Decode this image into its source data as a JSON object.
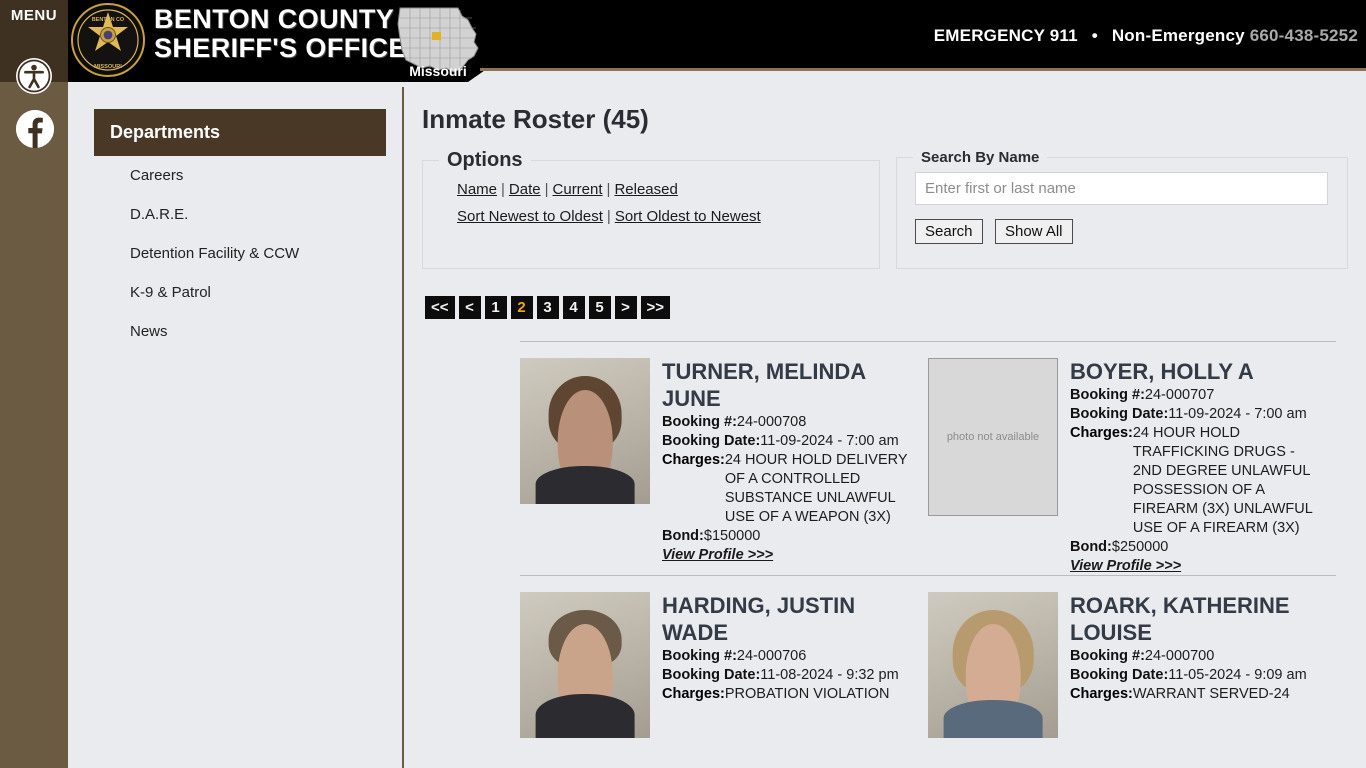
{
  "rail": {
    "menu_label": "MENU",
    "accessibility_icon": "accessibility-icon",
    "facebook_icon": "facebook-icon",
    "menu_icon": "hamburger-menu-icon"
  },
  "header": {
    "title_line1": "BENTON COUNTY",
    "title_line2": "SHERIFF'S OFFICE",
    "badge_icon": "sheriff-badge-icon",
    "state_map_icon": "missouri-map-icon",
    "state_label": "Missouri",
    "emergency_label": "EMERGENCY 911",
    "separator": "•",
    "non_emergency_label": "Non-Emergency",
    "non_emergency_number": "660-438-5252"
  },
  "sidebar": {
    "header": "Departments",
    "items": [
      {
        "label": "Careers"
      },
      {
        "label": "D.A.R.E."
      },
      {
        "label": "Detention Facility & CCW"
      },
      {
        "label": "K-9 & Patrol"
      },
      {
        "label": "News"
      }
    ]
  },
  "main": {
    "page_title": "Inmate Roster (45)",
    "options": {
      "legend": "Options",
      "row1": [
        {
          "label": "Name"
        },
        {
          "label": "Date"
        },
        {
          "label": "Current"
        },
        {
          "label": "Released"
        }
      ],
      "row2": [
        {
          "label": "Sort Newest to Oldest"
        },
        {
          "label": "Sort Oldest to Newest"
        }
      ],
      "separator": "|"
    },
    "search": {
      "legend": "Search By Name",
      "value": "",
      "placeholder": "Enter first or last name",
      "search_button": "Search",
      "show_all_button": "Show All"
    },
    "pagination": {
      "current": "2",
      "items": [
        {
          "label": "<<",
          "current": false
        },
        {
          "label": "<",
          "current": false
        },
        {
          "label": "1",
          "current": false
        },
        {
          "label": "2",
          "current": true
        },
        {
          "label": "3",
          "current": false
        },
        {
          "label": "4",
          "current": false
        },
        {
          "label": "5",
          "current": false
        },
        {
          "label": ">",
          "current": false
        },
        {
          "label": ">>",
          "current": false
        }
      ]
    },
    "labels": {
      "booking_number": "Booking #:",
      "booking_date": "Booking Date:",
      "charges": "Charges:",
      "bond": "Bond:",
      "view_profile": "View Profile >>>",
      "no_photo": "photo not available"
    },
    "inmates": [
      {
        "name": "TURNER, MELINDA JUNE",
        "booking_number": "24-000708",
        "booking_date": "11-09-2024 - 7:00 am",
        "charges": "24 HOUR HOLD DELIVERY OF A CONTROLLED SUBSTANCE UNLAWFUL USE OF A WEAPON (3X)",
        "bond": "$150000",
        "has_photo": true
      },
      {
        "name": "BOYER, HOLLY A",
        "booking_number": "24-000707",
        "booking_date": "11-09-2024 - 7:00 am",
        "charges": "24 HOUR HOLD TRAFFICKING DRUGS - 2ND DEGREE UNLAWFUL POSSESSION OF A FIREARM (3X) UNLAWFUL USE OF A FIREARM (3X)",
        "bond": "$250000",
        "has_photo": false
      },
      {
        "name": "HARDING, JUSTIN WADE",
        "booking_number": "24-000706",
        "booking_date": "11-08-2024 - 9:32 pm",
        "charges": "PROBATION VIOLATION",
        "bond": "",
        "has_photo": true
      },
      {
        "name": "ROARK, KATHERINE LOUISE",
        "booking_number": "24-000700",
        "booking_date": "11-05-2024 - 9:09 am",
        "charges": "WARRANT SERVED-24",
        "bond": "",
        "has_photo": true
      }
    ]
  },
  "colors": {
    "rail_dark": "#3f3121",
    "rail_light": "#6b5b43",
    "dept_header": "#4a3826",
    "page_bg": "#eaebee",
    "pager_current": "#eaa818",
    "header_rule": "#8c7356"
  }
}
